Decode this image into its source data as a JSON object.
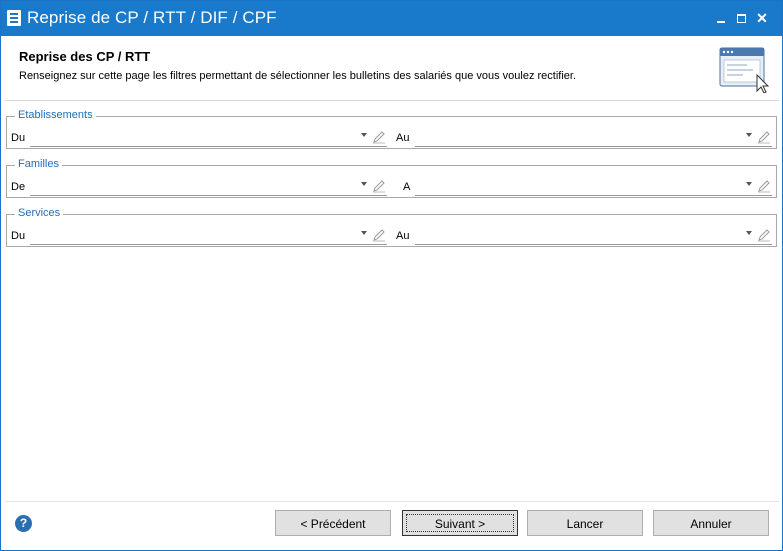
{
  "window": {
    "title": "Reprise de CP / RTT / DIF / CPF"
  },
  "header": {
    "title": "Reprise des CP / RTT",
    "description": "Renseignez sur cette page les filtres permettant de sélectionner les bulletins des salariés que vous voulez rectifier."
  },
  "groups": [
    {
      "legend": "Etablissements",
      "from_label": "Du",
      "to_label": "Au",
      "from_value": "",
      "to_value": ""
    },
    {
      "legend": "Familles",
      "from_label": "De",
      "to_label": "A",
      "from_value": "",
      "to_value": ""
    },
    {
      "legend": "Services",
      "from_label": "Du",
      "to_label": "Au",
      "from_value": "",
      "to_value": ""
    }
  ],
  "footer": {
    "help": "?",
    "previous": "< Précédent",
    "next": "Suivant >",
    "launch": "Lancer",
    "cancel": "Annuler"
  },
  "colors": {
    "titlebar": "#1979ca",
    "legend_text": "#1f6fb8",
    "button_bg": "#e1e1e1"
  },
  "icons": {
    "app": "app-list-icon",
    "minimize": "minimize-icon",
    "maximize": "maximize-icon",
    "close": "close-icon",
    "header": "window-cursor-illustration",
    "combo_arrow": "dropdown-arrow-icon",
    "combo_edit": "pencil-icon",
    "help": "help-icon"
  }
}
